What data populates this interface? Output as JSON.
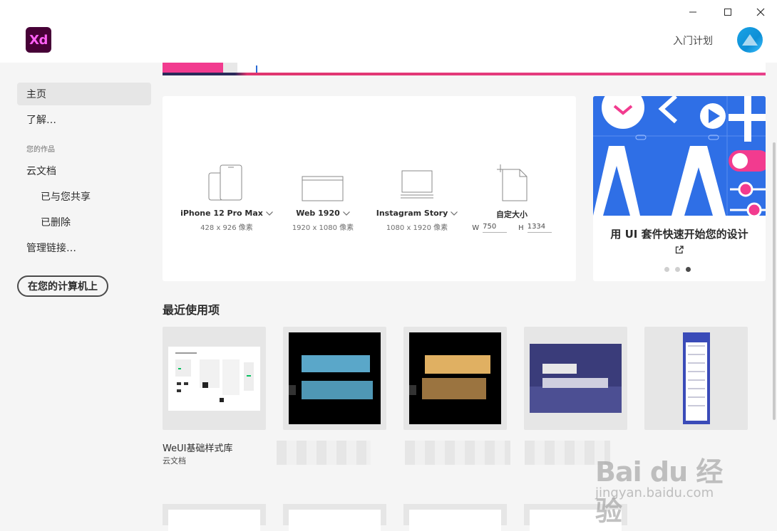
{
  "app": {
    "logo_text": "Xd",
    "brand_color": "#470137",
    "brand_accent": "#ff61f6"
  },
  "titlebar": {
    "learn_link": "入门计划",
    "window_controls": [
      "minimize-icon",
      "maximize-icon",
      "close-icon"
    ]
  },
  "sidebar": {
    "items": [
      {
        "label": "主页",
        "active": true
      },
      {
        "label": "了解…"
      }
    ],
    "section_label": "您的作品",
    "works": [
      {
        "label": "云文档"
      },
      {
        "label": "已与您共享"
      },
      {
        "label": "已删除"
      },
      {
        "label": "管理链接…"
      }
    ],
    "local_button": "在您的计算机上"
  },
  "presets": [
    {
      "name": "iPhone 12 Pro Max",
      "size": "428 x 926 像素",
      "icon": "phone-icon"
    },
    {
      "name": "Web 1920",
      "size": "1920 x 1080 像素",
      "icon": "browser-icon"
    },
    {
      "name": "Instagram Story",
      "size": "1080 x 1920 像素",
      "icon": "monitor-icon"
    }
  ],
  "custom_preset": {
    "name": "自定大小",
    "w_label": "W",
    "w_value": "750",
    "h_label": "H",
    "h_value": "1334",
    "icon": "document-icon"
  },
  "promo": {
    "caption": "用 UI 套件快速开始您的设计",
    "link_icon": "external-link-icon",
    "slide_count": 3,
    "active_slide": 3,
    "art_color": "#2f6fe6"
  },
  "recent": {
    "title": "最近使用项",
    "items": [
      {
        "title": "WeUI基础样式库",
        "location": "云文档"
      }
    ]
  },
  "watermark": {
    "main": "Bai du 经验",
    "sub": "jingyan.baidu.com"
  }
}
